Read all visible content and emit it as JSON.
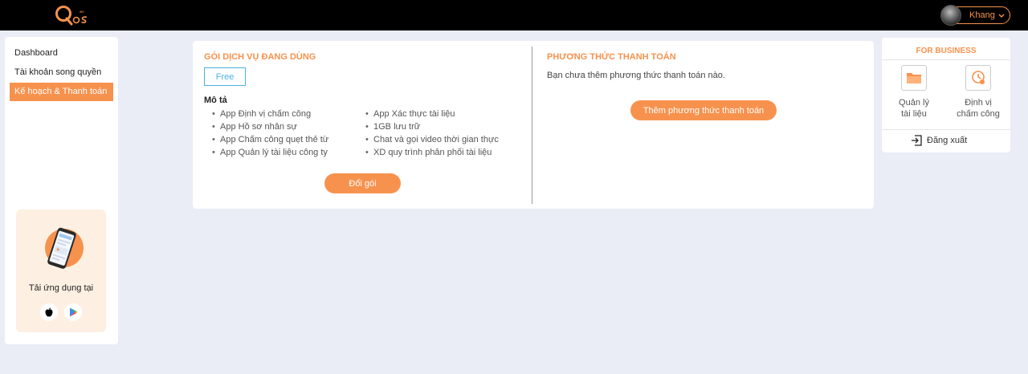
{
  "header": {
    "logo_text": "OS",
    "user_name": "Khang"
  },
  "sidebar": {
    "items": [
      {
        "label": "Dashboard"
      },
      {
        "label": "Tài khoản song quyền"
      },
      {
        "label": "Kế hoạch & Thanh toán",
        "active": true
      }
    ],
    "app_download": {
      "text": "Tải ứng dụng tại",
      "stores": [
        "apple-icon",
        "google-play-icon"
      ]
    }
  },
  "plan": {
    "title": "GÓI DỊCH VỤ ĐANG DÙNG",
    "badge": "Free",
    "desc_title": "Mô tả",
    "features_left": [
      "App Định vị chấm công",
      "App Hồ sơ nhân sự",
      "App Chấm công quẹt thẻ từ",
      "App Quản lý tài liệu công ty"
    ],
    "features_right": [
      "App Xác thực tài liệu",
      "1GB lưu trữ",
      "Chat và gọi video thời gian thực",
      "XD quy trình phân phối tài liệu"
    ],
    "change_button": "Đổi gói"
  },
  "payment": {
    "title": "PHƯƠNG THỨC THANH TOÁN",
    "empty_text": "Bạn chưa thêm phương thức thanh toán nào.",
    "add_button": "Thêm phương thức thanh toán"
  },
  "business": {
    "title": "FOR BUSINESS",
    "apps": [
      {
        "label_line1": "Quản lý",
        "label_line2": "tài liệu",
        "icon": "folder-icon"
      },
      {
        "label_line1": "Định vị",
        "label_line2": "chấm công",
        "icon": "clock-location-icon"
      }
    ],
    "logout": "Đăng xuất"
  },
  "colors": {
    "accent": "#f7924e",
    "badge_blue": "#4cb1e3",
    "background": "#eaecf6"
  }
}
